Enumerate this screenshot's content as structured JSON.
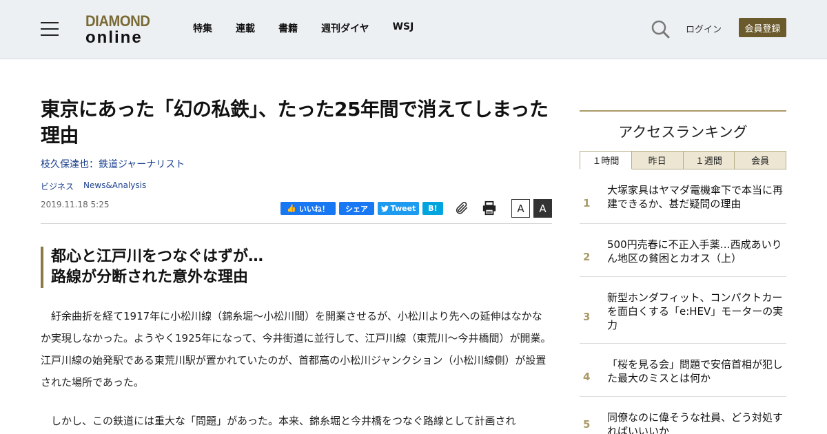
{
  "header": {
    "logo_line1": "DIAMOND",
    "logo_line2": "online",
    "nav": [
      "特集",
      "連載",
      "書籍",
      "週刊ダイヤ",
      "WSJ"
    ],
    "login": "ログイン",
    "register": "会員登録"
  },
  "article": {
    "title": "東京にあった「幻の私鉄」、たった25年間で消えてしまった理由",
    "author": "枝久保達也：鉄道ジャーナリスト",
    "tags": [
      "ビジネス",
      "News&Analysis"
    ],
    "date": "2019.11.18 5:25",
    "share": {
      "fb_like": "いいね！",
      "fb_share": "シェア",
      "tweet": "Tweet",
      "hatena": "B!"
    },
    "font_small": "A",
    "font_large": "A",
    "subhead_line1": "都心と江戸川をつなぐはずが…",
    "subhead_line2": "路線が分断された意外な理由",
    "para1": "紆余曲折を経て1917年に小松川線（錦糸堀～小松川間）を開業させるが、小松川より先への延伸はなかなか実現しなかった。ようやく1925年になって、今井街道に並行して、江戸川線（東荒川～今井橋間）が開業。江戸川線の始発駅である東荒川駅が置かれていたのが、首都高の小松川ジャンクション（小松川線側）が設置された場所であった。",
    "para2": "しかし、この鉄道には重大な「問題」があった。本来、錦糸堀と今井橋をつなぐ路線として計画され"
  },
  "ranking": {
    "title": "アクセスランキング",
    "tabs": [
      "１時間",
      "昨日",
      "１週間",
      "会員"
    ],
    "items": [
      {
        "rank": "1",
        "text": "大塚家具はヤマダ電機傘下で本当に再建できるか、甚だ疑問の理由"
      },
      {
        "rank": "2",
        "text": "500円売春に不正入手薬…西成あいりん地区の貧困とカオス（上）"
      },
      {
        "rank": "3",
        "text": "新型ホンダフィット、コンパクトカーを面白くする「e:HEV」モーターの実力"
      },
      {
        "rank": "4",
        "text": "「桜を見る会」問題で安倍首相が犯した最大のミスとは何か"
      },
      {
        "rank": "5",
        "text": "同僚なのに偉そうな社員、どう対処すればいいいか"
      }
    ]
  },
  "colors": {
    "brand_gold": "#6b5a2c",
    "link_blue": "#1a3f8e",
    "facebook": "#1877f2",
    "twitter": "#1d9bf0",
    "hatena": "#00a4de"
  }
}
